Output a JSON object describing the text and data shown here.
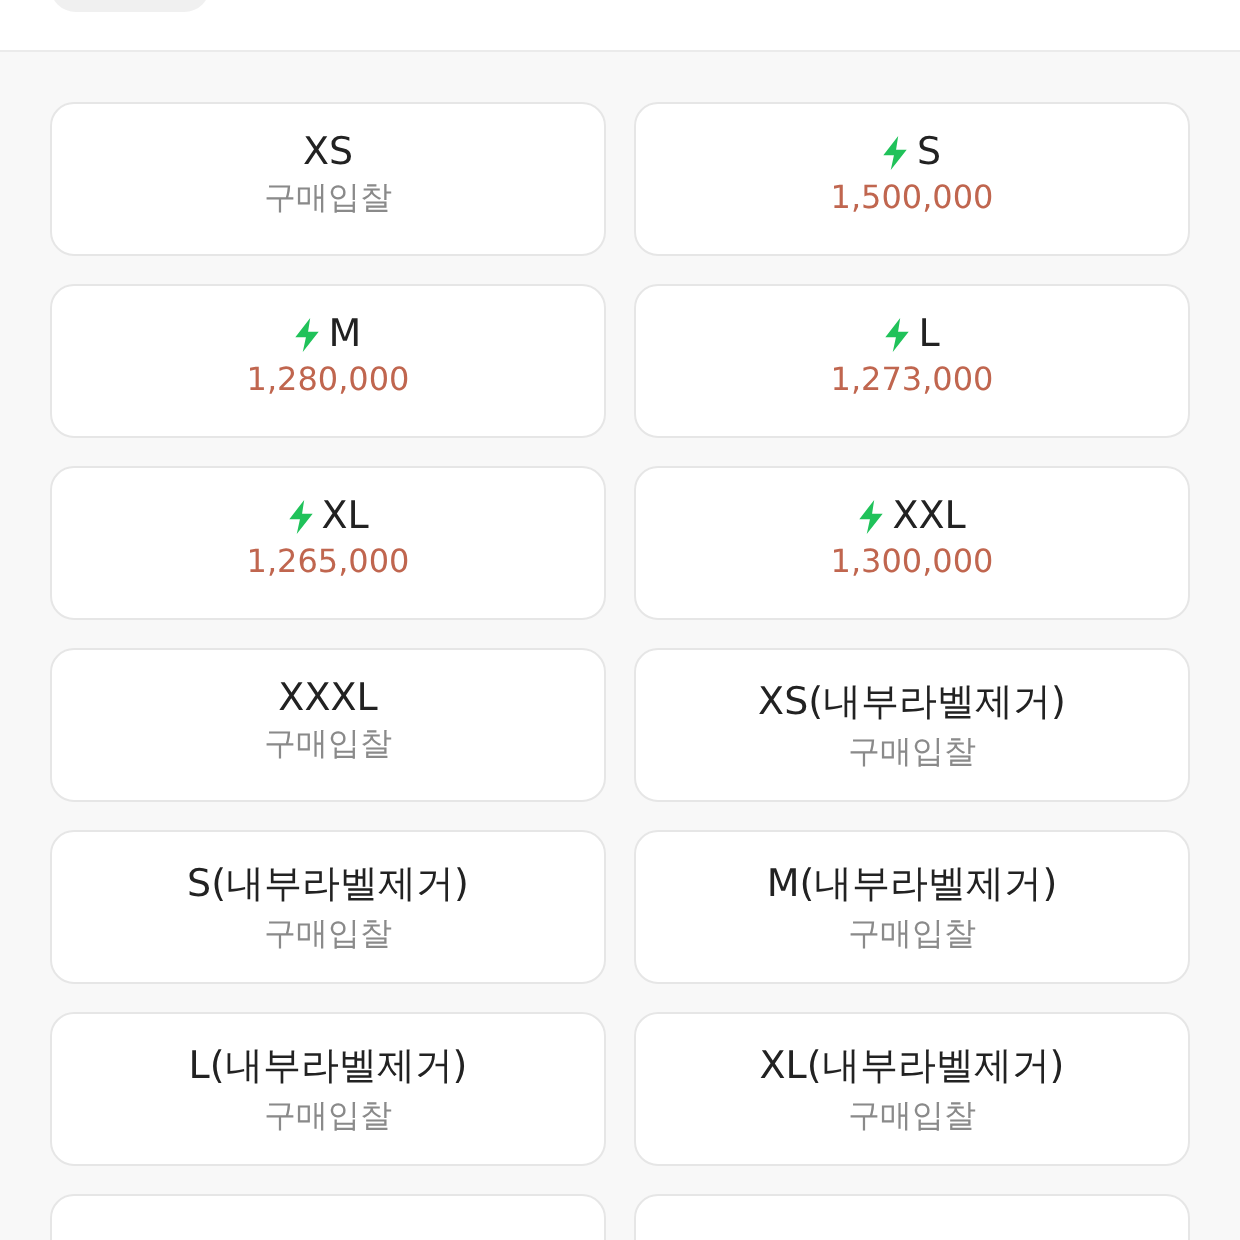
{
  "options": [
    {
      "size": "XS",
      "quick": false,
      "kind": "bid",
      "sub": "구매입찰"
    },
    {
      "size": "S",
      "quick": true,
      "kind": "price",
      "sub": "1,500,000"
    },
    {
      "size": "M",
      "quick": true,
      "kind": "price",
      "sub": "1,280,000"
    },
    {
      "size": "L",
      "quick": true,
      "kind": "price",
      "sub": "1,273,000"
    },
    {
      "size": "XL",
      "quick": true,
      "kind": "price",
      "sub": "1,265,000"
    },
    {
      "size": "XXL",
      "quick": true,
      "kind": "price",
      "sub": "1,300,000"
    },
    {
      "size": "XXXL",
      "quick": false,
      "kind": "bid",
      "sub": "구매입찰"
    },
    {
      "size": "XS(내부라벨제거)",
      "quick": false,
      "kind": "bid",
      "sub": "구매입찰"
    },
    {
      "size": "S(내부라벨제거)",
      "quick": false,
      "kind": "bid",
      "sub": "구매입찰"
    },
    {
      "size": "M(내부라벨제거)",
      "quick": false,
      "kind": "bid",
      "sub": "구매입찰"
    },
    {
      "size": "L(내부라벨제거)",
      "quick": false,
      "kind": "bid",
      "sub": "구매입찰"
    },
    {
      "size": "XL(내부라벨제거)",
      "quick": false,
      "kind": "bid",
      "sub": "구매입찰"
    },
    {
      "kind": "cut"
    },
    {
      "kind": "cut"
    }
  ]
}
